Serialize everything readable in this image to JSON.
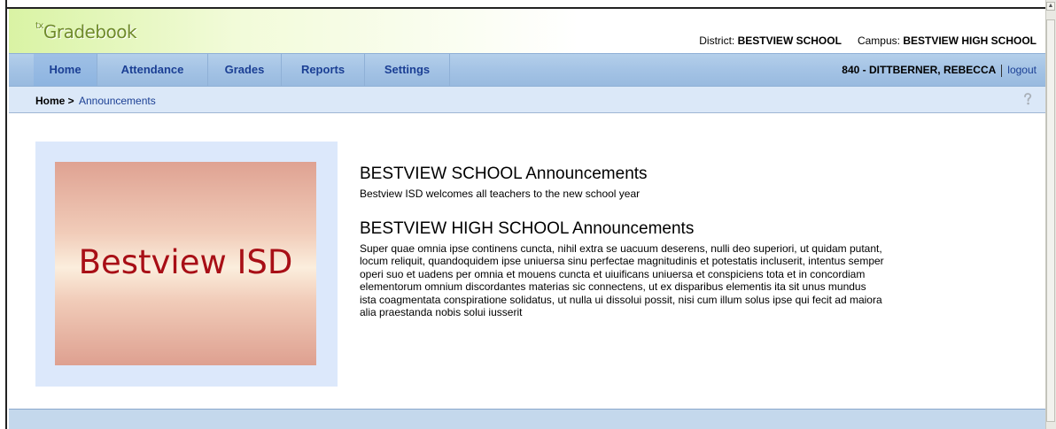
{
  "app": {
    "logo_prefix": "tx",
    "logo_text": "Gradebook"
  },
  "header": {
    "district_label": "District:",
    "district_value": "BESTVIEW SCHOOL",
    "campus_label": "Campus:",
    "campus_value": "BESTVIEW HIGH SCHOOL"
  },
  "nav": {
    "items": [
      {
        "label": "Home",
        "active": true
      },
      {
        "label": "Attendance"
      },
      {
        "label": "Grades"
      },
      {
        "label": "Reports"
      },
      {
        "label": "Settings"
      }
    ],
    "user": "840 - DITTBERNER, REBECCA",
    "logout": "logout"
  },
  "breadcrumb": {
    "home": "Home >",
    "current": "Announcements",
    "help_icon": "question-mark-icon"
  },
  "logo_panel": {
    "text": "Bestview ISD"
  },
  "announcements": {
    "district_title": "BESTVIEW SCHOOL Announcements",
    "district_body": "Bestview ISD welcomes all teachers to the new school year",
    "campus_title": "BESTVIEW HIGH SCHOOL Announcements",
    "campus_body_lines": [
      "Super quae omnia ipse continens cuncta, nihil extra se uacuum deserens, nulli deo superiori, ut quidam putant,",
      "locum reliquit, quandoquidem ipse uniuersa sinu perfectae magnitudinis et potestatis incluserit, intentus semper",
      "operi suo et uadens per omnia et mouens cuncta et uiuificans uniuersa et conspiciens tota et in concordiam",
      "elementorum omnium discordantes materias sic connectens, ut ex disparibus elementis ita sit unus mundus",
      "ista coagmentata conspiratione solidatus, ut nulla ui dissolui possit, nisi cum illum solus ipse qui fecit ad maiora",
      "alia praestanda nobis solui iusserit"
    ]
  },
  "colors": {
    "nav_text": "#1b3f94",
    "logo_green": "#6f8a2b",
    "logo_red": "#a80f16"
  }
}
